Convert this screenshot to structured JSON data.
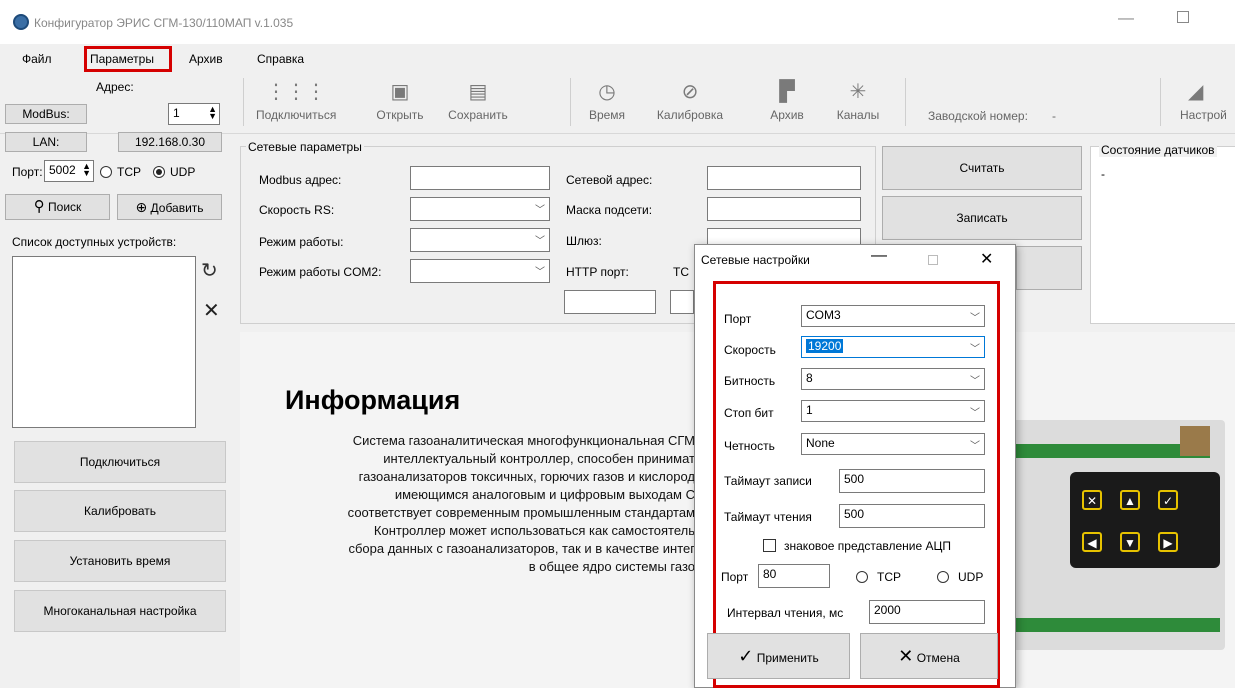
{
  "window": {
    "title": "Конфигуратор ЭРИС СГМ-130/110МАП v.1.035"
  },
  "menu": [
    "Файл",
    "Параметры",
    "Архив",
    "Справка"
  ],
  "toolbar": {
    "buttons": [
      "Подключиться",
      "Открыть",
      "Сохранить",
      "Время",
      "Калибровка",
      "Архив",
      "Каналы"
    ],
    "serial_label": "Заводской номер:",
    "serial_value": "-",
    "settings_label": "Настрой"
  },
  "left": {
    "address_label": "Адрес:",
    "modbus_btn": "ModBus:",
    "modbus_addr": "1",
    "lan_btn": "LAN:",
    "ip": "192.168.0.30",
    "port_label": "Порт:",
    "port_value": "5002",
    "tcp_label": "TCP",
    "udp_label": "UDP",
    "search_label": "Поиск",
    "add_label": "Добавить",
    "devices_label": "Список доступных устройств:",
    "buttons": [
      "Подключиться",
      "Калибровать",
      "Установить время",
      "Многоканальная настройка"
    ]
  },
  "network": {
    "group_title": "Сетевые параметры",
    "modbus_addr": "Modbus адрес:",
    "rs_speed": "Скорость RS:",
    "mode": "Режим работы:",
    "mode_com2": "Режим работы COM2:",
    "net_addr": "Сетевой адрес:",
    "subnet": "Маска подсети:",
    "gateway": "Шлюз:",
    "http_port": "HTTP порт:",
    "tc_cut": "TC",
    "read_btn": "Считать",
    "write_btn": "Записать"
  },
  "sensors": {
    "title": "Состояние датчиков",
    "value": "-"
  },
  "info": {
    "heading": "Информация",
    "lines": [
      "Система газоаналитическая многофункциональная СГМ",
      "интеллектуальный контроллер, способен принимат",
      "газоанализаторов токсичных, горючих газов и кислород",
      "имеющимся аналоговым и цифровым выходам С",
      "соответствует современным промышленным стандартам",
      "Контроллер может использоваться как самостоятель",
      "сбора данных с газоанализаторов, так и в качестве интег",
      "в общее ядро системы газо"
    ]
  },
  "dialog": {
    "title": "Сетевые настройки",
    "port_label": "Порт",
    "port_value": "COM3",
    "speed_label": "Скорость",
    "speed_value": "19200",
    "bits_label": "Битность",
    "bits_value": "8",
    "stop_label": "Стоп бит",
    "stop_value": "1",
    "parity_label": "Четность",
    "parity_value": "None",
    "write_timeout_label": "Таймаут записи",
    "write_timeout_value": "500",
    "read_timeout_label": "Таймаут чтения",
    "read_timeout_value": "500",
    "adc_label": "знаковое представление АЦП",
    "net_port_label": "Порт",
    "net_port_value": "80",
    "tcp_label": "TCP",
    "udp_label": "UDP",
    "interval_label": "Интервал чтения, мс",
    "interval_value": "2000",
    "apply_label": "Применить",
    "cancel_label": "Отмена"
  },
  "colors": {
    "highlight": "#d50000",
    "selection": "#0078d7"
  }
}
